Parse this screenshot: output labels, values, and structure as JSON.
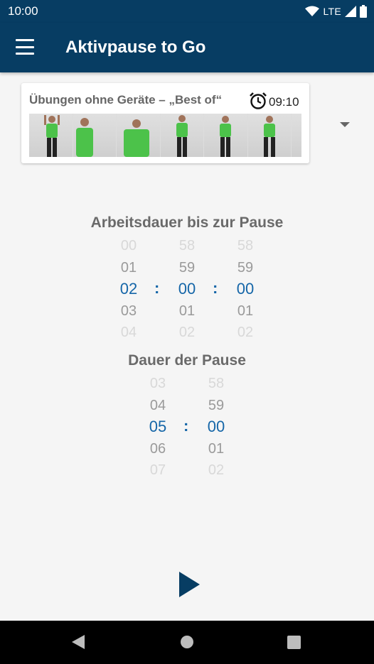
{
  "status_bar": {
    "time": "10:00",
    "network": "LTE",
    "icons": [
      "wifi-icon",
      "signal-icon",
      "battery-icon"
    ]
  },
  "app_bar": {
    "title": "Aktivpause to Go",
    "menu_icon": "hamburger-menu-icon"
  },
  "program": {
    "title": "Übungen ohne Geräte – „Best of“",
    "duration": "09:10",
    "alarm_icon": "alarm-clock-icon",
    "dropdown_icon": "dropdown-arrow-icon"
  },
  "work_duration": {
    "title": "Arbeitsdauer bis zur Pause",
    "hours": [
      "00",
      "01",
      "02",
      "03",
      "04"
    ],
    "minutes": [
      "58",
      "59",
      "00",
      "01",
      "02"
    ],
    "seconds": [
      "58",
      "59",
      "00",
      "01",
      "02"
    ],
    "separator": ":"
  },
  "break_duration": {
    "title": "Dauer der Pause",
    "minutes": [
      "03",
      "04",
      "05",
      "06",
      "07"
    ],
    "seconds": [
      "58",
      "59",
      "00",
      "01",
      "02"
    ],
    "separator": ":"
  },
  "play_icon": "play-icon",
  "nav_bar": {
    "back_icon": "back-triangle-icon",
    "home_icon": "home-circle-icon",
    "recents_icon": "recents-square-icon"
  },
  "colors": {
    "primary": "#073d63",
    "selected": "#1566a8",
    "shirt": "#4cc24a"
  }
}
